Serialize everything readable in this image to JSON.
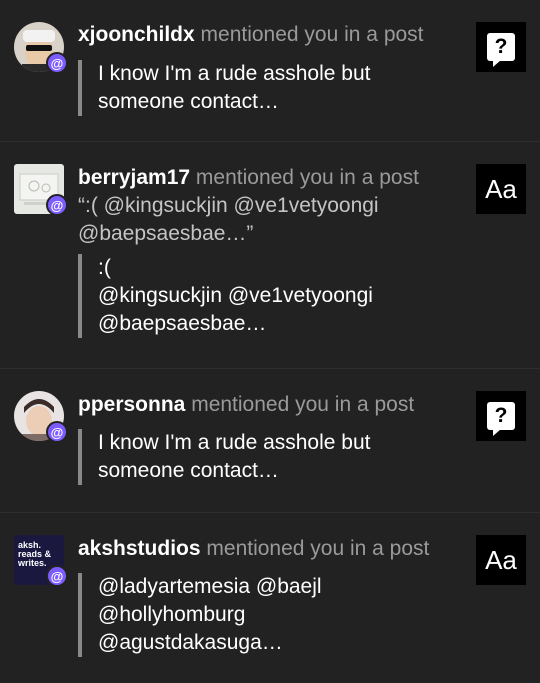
{
  "notifications": [
    {
      "username": "xjoonchildx",
      "action": "mentioned you in a post",
      "snippet": "",
      "quote_lines": [
        "I know I'm a rude asshole but",
        "someone contact…"
      ],
      "thumb": "question-icon"
    },
    {
      "username": "berryjam17",
      "action": "mentioned you in a post",
      "snippet": "“:(  @kingsuckjin @ve1vetyoongi @baepsaesbae…”",
      "quote_lines": [
        ":(",
        "@kingsuckjin @ve1vetyoongi",
        "@baepsaesbae…"
      ],
      "thumb": "Aa"
    },
    {
      "username": "ppersonna",
      "action": "mentioned you in a post",
      "snippet": "",
      "quote_lines": [
        "I know I'm a rude asshole but",
        "someone contact…"
      ],
      "thumb": "question-icon"
    },
    {
      "username": "akshstudios",
      "action": "mentioned you in a post",
      "snippet": "",
      "quote_lines": [
        "@ladyartemesia @baejl",
        "@hollyhomburg",
        "@agustdakasuga…"
      ],
      "thumb": "Aa"
    }
  ],
  "avatar_logo_text": [
    "aksh.",
    "reads &",
    "writes."
  ],
  "badge_glyph": "@",
  "colors": {
    "badge": "#7c5cff",
    "background": "#222222"
  }
}
